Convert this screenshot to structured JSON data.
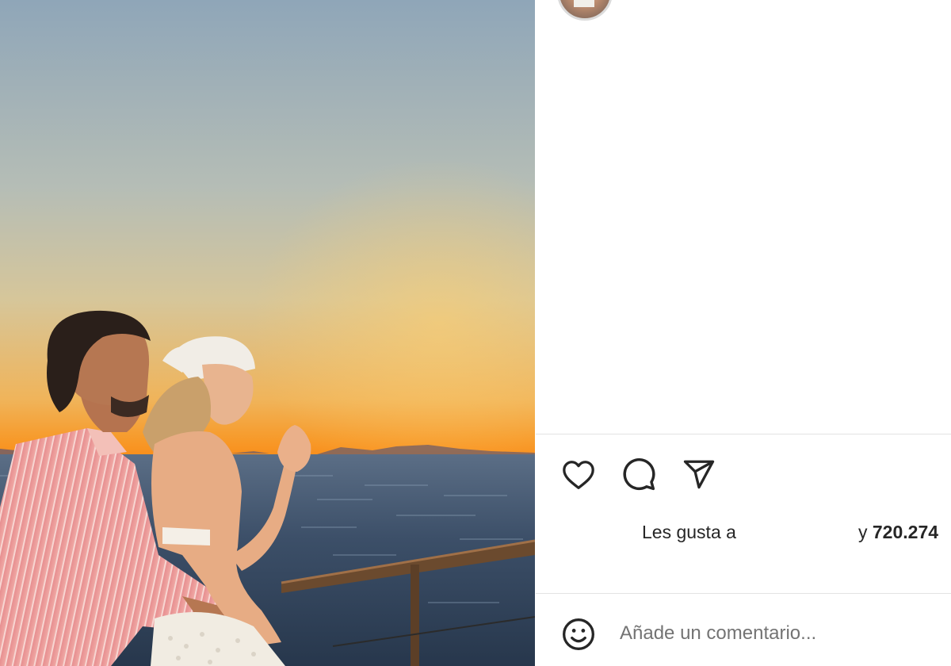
{
  "post": {
    "image": {
      "alt": ""
    },
    "author": {
      "avatar": "profile-avatar"
    }
  },
  "actions": {
    "like_icon": "heart-icon",
    "comment_icon": "comment-icon",
    "share_icon": "paper-plane-icon"
  },
  "likes": {
    "prefix": "Les gusta a",
    "conjunction": "y",
    "count": "720.274"
  },
  "comment_box": {
    "emoji_icon": "emoji-icon",
    "placeholder": "Añade un comentario..."
  }
}
